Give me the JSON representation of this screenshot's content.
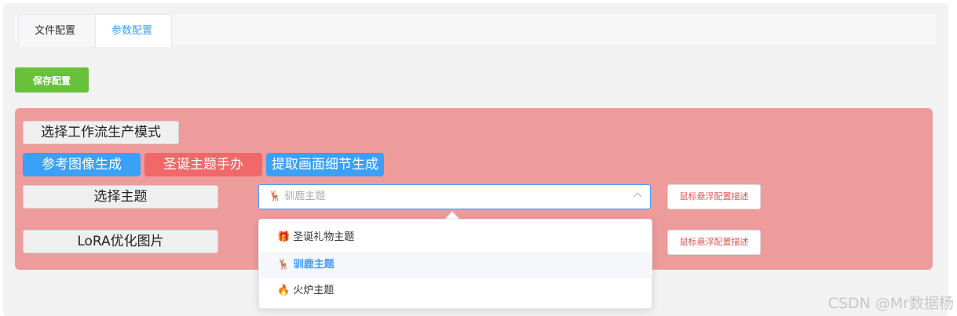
{
  "tabs": [
    {
      "label": "文件配置"
    },
    {
      "label": "参数配置"
    }
  ],
  "toolbar": {
    "save_label": "保存配置"
  },
  "workflow": {
    "mode_label": "选择工作流生产模式",
    "options": [
      {
        "label": "参考图像生成"
      },
      {
        "label": "圣诞主题手办"
      },
      {
        "label": "提取画面细节生成"
      }
    ]
  },
  "theme": {
    "label": "选择主题",
    "selected": "🦌 驯鹿主题",
    "hint": "鼠标悬浮配置描述"
  },
  "lora": {
    "label": "LoRA优化图片",
    "hint": "鼠标悬浮配置描述"
  },
  "dropdown": {
    "items": [
      {
        "label": "🎁 圣诞礼物主题"
      },
      {
        "label": "🦌 驯鹿主题"
      },
      {
        "label": "🔥 火炉主题"
      }
    ]
  },
  "watermark": "CSDN @Mr数据杨",
  "colors": {
    "accent": "#409eff",
    "save": "#67c23a",
    "pink_area": "#ee9b9b",
    "option_blue": "#3aa0f8",
    "option_red": "#f06868"
  }
}
